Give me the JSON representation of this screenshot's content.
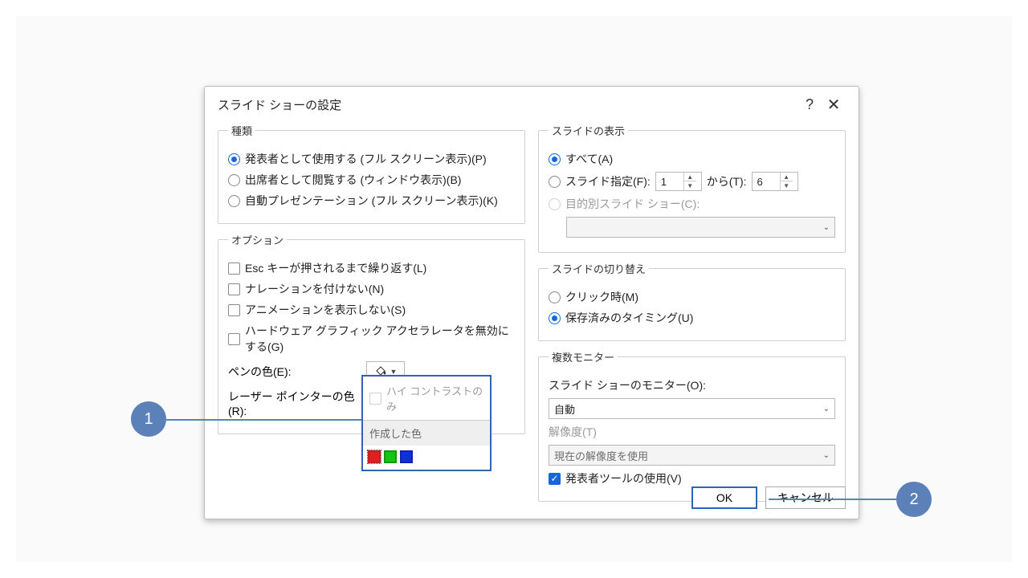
{
  "dialog": {
    "title": "スライド ショーの設定",
    "help": "?",
    "close": "✕"
  },
  "type_group": {
    "legend": "種類",
    "opt1": "発表者として使用する (フル スクリーン表示)(P)",
    "opt2": "出席者として閲覧する (ウィンドウ表示)(B)",
    "opt3": "自動プレゼンテーション (フル スクリーン表示)(K)"
  },
  "options_group": {
    "legend": "オプション",
    "loop": "Esc キーが押されるまで繰り返す(L)",
    "narration": "ナレーションを付けない(N)",
    "animation": "アニメーションを表示しない(S)",
    "hwaccel": "ハードウェア グラフィック アクセラレータを無効にする(G)",
    "pen_label": "ペンの色(E):",
    "laser_label": "レーザー ポインターの色(R):"
  },
  "show_group": {
    "legend": "スライドの表示",
    "all": "すべて(A)",
    "range_label": "スライド指定(F):",
    "from": "1",
    "to_label": "から(T):",
    "to": "6",
    "custom_label": "目的別スライド ショー(C):"
  },
  "advance_group": {
    "legend": "スライドの切り替え",
    "manual": "クリック時(M)",
    "timing": "保存済みのタイミング(U)"
  },
  "monitor_group": {
    "legend": "複数モニター",
    "monitor_label": "スライド ショーのモニター(O):",
    "monitor_value": "自動",
    "res_label": "解像度(T)",
    "res_value": "現在の解像度を使用",
    "presenter": "発表者ツールの使用(V)"
  },
  "popover": {
    "high_contrast": "ハイ コントラストのみ",
    "recent_label": "作成した色"
  },
  "footer": {
    "ok": "OK",
    "cancel": "キャンセル"
  },
  "badges": {
    "b1": "1",
    "b2": "2"
  },
  "colors": {
    "pen_underline": "#d62020",
    "laser_underline": "#d62020"
  }
}
